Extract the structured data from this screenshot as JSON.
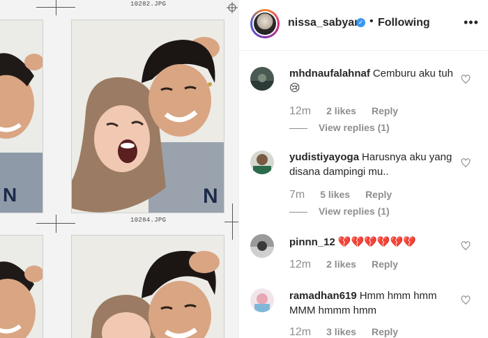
{
  "left_panel": {
    "file_labels": [
      "10282.JPG",
      "10284.JPG"
    ]
  },
  "header": {
    "username": "nissa_sabyan",
    "verified_icon": "verified-badge-icon",
    "separator": "•",
    "follow_status": "Following",
    "more_icon": "•••"
  },
  "comments": [
    {
      "username": "mhdnaufalahnaf",
      "text": "Cemburu aku tuh😢",
      "time": "12m",
      "likes": "2 likes",
      "reply": "Reply",
      "view_replies": "View replies (1)"
    },
    {
      "username": "yudistiyayoga",
      "text": "Harusnya aku yang disana dampingi mu..",
      "time": "7m",
      "likes": "5 likes",
      "reply": "Reply",
      "view_replies": "View replies (1)"
    },
    {
      "username": "pinnn_12",
      "text": "💔💔💔💔💔💔",
      "time": "12m",
      "likes": "2 likes",
      "reply": "Reply"
    },
    {
      "username": "ramadhan619",
      "text": "Hmm hmm hmm MMM hmmm hmm",
      "time": "12m",
      "likes": "3 likes",
      "reply": "Reply"
    }
  ],
  "colors": {
    "text": "#262626",
    "meta": "#8e8e8e",
    "verified": "#3897f0",
    "border": "#efefef"
  }
}
